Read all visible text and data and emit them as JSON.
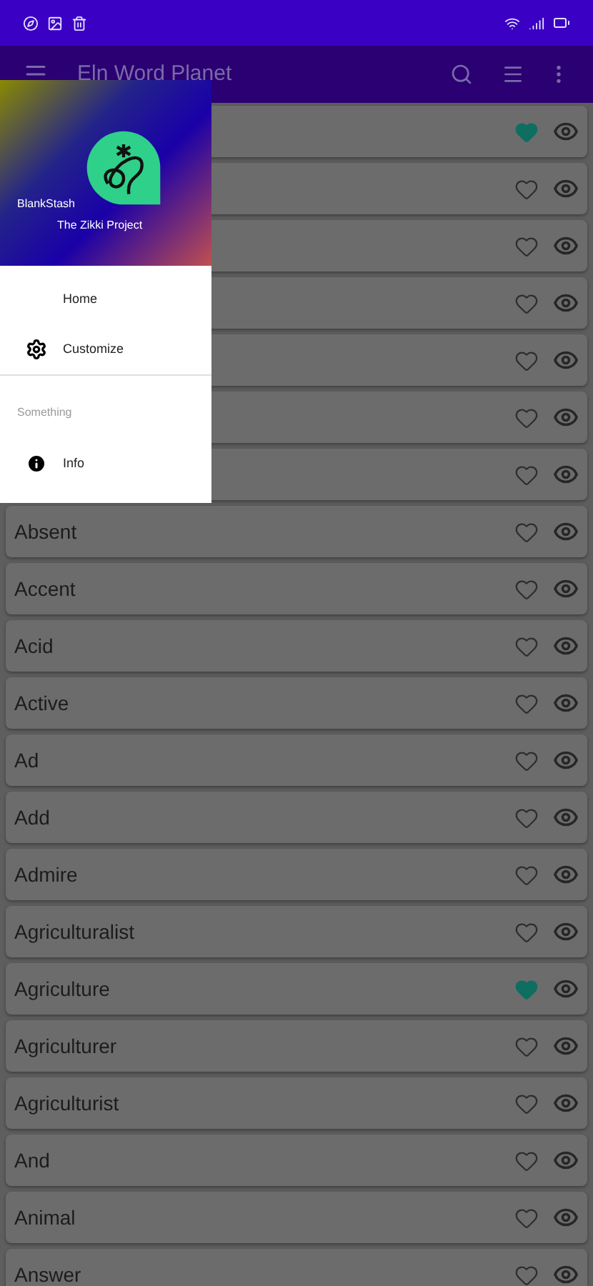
{
  "app_bar": {
    "title": "Eln Word Planet"
  },
  "drawer": {
    "header": {
      "user": "BlankStash",
      "project": "The Zikki Project"
    },
    "items": [
      {
        "kind": "entry",
        "label": "Home"
      },
      {
        "kind": "entry",
        "label": "Customize"
      },
      {
        "kind": "section",
        "label": "Something"
      },
      {
        "kind": "entry",
        "label": "Info"
      }
    ]
  },
  "words": [
    {
      "favorite": true
    },
    {
      "favorite": false
    },
    {
      "favorite": false
    },
    {
      "favorite": false
    },
    {
      "favorite": false
    },
    {
      "favorite": false
    },
    {
      "favorite": false
    },
    {
      "word": "Absent",
      "favorite": false
    },
    {
      "word": "Accent",
      "favorite": false
    },
    {
      "word": "Acid",
      "favorite": false
    },
    {
      "word": "Active",
      "favorite": false
    },
    {
      "word": "Ad",
      "favorite": false
    },
    {
      "word": "Add",
      "favorite": false
    },
    {
      "word": "Admire",
      "favorite": false
    },
    {
      "word": "Agriculturalist",
      "favorite": false
    },
    {
      "word": "Agriculture",
      "favorite": true
    },
    {
      "word": "Agriculturer",
      "favorite": false
    },
    {
      "word": "Agriculturist",
      "favorite": false
    },
    {
      "word": "And",
      "favorite": false
    },
    {
      "word": "Animal",
      "favorite": false
    },
    {
      "word": "Answer",
      "favorite": false
    }
  ]
}
